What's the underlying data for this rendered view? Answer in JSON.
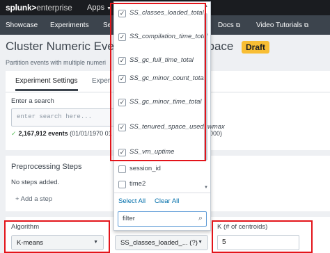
{
  "topbar": {
    "brand_main": "splunk>",
    "brand_suffix": "enterprise",
    "apps_label": "Apps"
  },
  "navbar": {
    "items": [
      {
        "label": "Showcase"
      },
      {
        "label": "Experiments"
      },
      {
        "label": "Se"
      },
      {
        "label": "Docs",
        "external": true
      },
      {
        "label": "Video Tutorials",
        "external": true
      }
    ]
  },
  "page": {
    "title": "Cluster Numeric Eve",
    "title_tail": "space",
    "badge": "Draft",
    "description": "Partition events with multiple numeri"
  },
  "tabs": [
    {
      "label": "Experiment Settings",
      "active": true
    },
    {
      "label": "Experi",
      "active": false
    }
  ],
  "search": {
    "label": "Enter a search",
    "placeholder": "enter search here..."
  },
  "events": {
    "count": "2,167,912 events",
    "range": "(01/01/1970 01",
    "tail": "000)"
  },
  "preprocessing": {
    "title": "Preprocessing Steps",
    "empty": "No steps added.",
    "add_step": "+ Add a step"
  },
  "algorithm": {
    "label": "Algorithm",
    "value": "K-means"
  },
  "fields": {
    "value": "SS_classes_loaded_... (?)"
  },
  "k": {
    "label": "K (# of centroids)",
    "value": "5"
  },
  "dropdown": {
    "options": [
      {
        "label": "SS_classes_loaded_total",
        "checked": true
      },
      {
        "label": "SS_compilation_time_total",
        "checked": true
      },
      {
        "label": "SS_gc_full_time_total",
        "checked": true
      },
      {
        "label": "SS_gc_minor_count_total",
        "checked": true
      },
      {
        "label": "SS_gc_minor_time_total",
        "checked": true
      },
      {
        "label": "SS_tenured_space_used_wmax",
        "checked": true
      },
      {
        "label": "SS_vm_uptime",
        "checked": true
      },
      {
        "label": "session_id",
        "checked": false
      },
      {
        "label": "time2",
        "checked": false
      }
    ],
    "select_all": "Select All",
    "clear_all": "Clear All",
    "filter_value": "filter"
  },
  "icons": {
    "apps_caret": "caret-down-icon",
    "external": "external-link-icon",
    "check": "checkmark-icon",
    "search": "magnifier-icon",
    "scroll_up": "scroll-up-icon",
    "scroll_down": "scroll-down-icon"
  },
  "colors": {
    "topbar": "#1a1c20",
    "navbar": "#3c444d",
    "draft_badge": "#f8be34",
    "link": "#006eaa",
    "annotation": "#e3141a",
    "success": "#5cc05c"
  }
}
